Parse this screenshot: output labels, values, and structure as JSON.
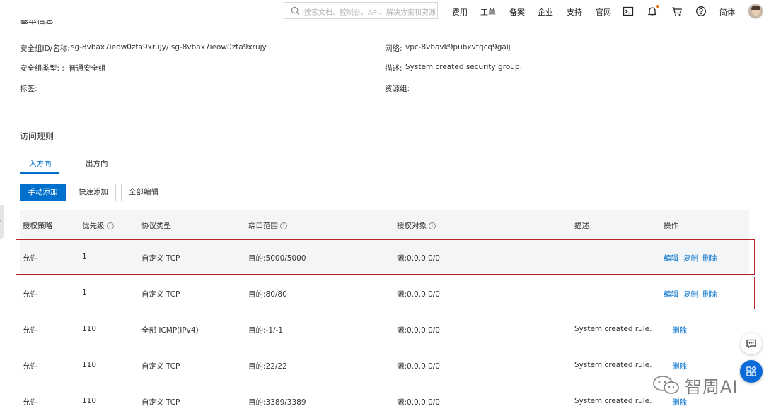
{
  "topbar": {
    "search_placeholder": "搜索文档、控制台、API、解决方案和资源",
    "nav": [
      "费用",
      "工单",
      "备案",
      "企业",
      "支持",
      "官网"
    ],
    "lang": "简体"
  },
  "basic_info": {
    "section_title": "基本信息",
    "sg_id_label": "安全组ID/名称:",
    "sg_id_value": "sg-8vbax7ieow0zta9xrujy/ sg-8vbax7ieow0zta9xrujy",
    "sg_type_label": "安全组类型: :",
    "sg_type_value": "普通安全组",
    "tags_label": "标签:",
    "network_label": "网络:",
    "network_value": "vpc-8vbavk9pubxvtqcq9gaij",
    "desc_label": "描述:",
    "desc_value": "System created security group.",
    "resource_group_label": "资源组:"
  },
  "rules": {
    "title": "访问规则",
    "tabs": [
      "入方向",
      "出方向"
    ],
    "active_tab": "入方向",
    "buttons": {
      "manual_add": "手动添加",
      "quick_add": "快速添加",
      "edit_all": "全部编辑"
    },
    "columns": [
      "授权策略",
      "优先级",
      "协议类型",
      "端口范围",
      "授权对象",
      "描述",
      "操作"
    ],
    "rows": [
      {
        "policy": "允许",
        "priority": "1",
        "protocol": "自定义 TCP",
        "port": "目的:5000/5000",
        "target": "源:0.0.0.0/0",
        "desc": "",
        "ops": [
          "编辑",
          "复制",
          "删除"
        ]
      },
      {
        "policy": "允许",
        "priority": "1",
        "protocol": "自定义 TCP",
        "port": "目的:80/80",
        "target": "源:0.0.0.0/0",
        "desc": "",
        "ops": [
          "编辑",
          "复制",
          "删除"
        ]
      },
      {
        "policy": "允许",
        "priority": "110",
        "protocol": "全部 ICMP(IPv4)",
        "port": "目的:-1/-1",
        "target": "源:0.0.0.0/0",
        "desc": "System created rule.",
        "ops": [
          "删除"
        ]
      },
      {
        "policy": "允许",
        "priority": "110",
        "protocol": "自定义 TCP",
        "port": "目的:22/22",
        "target": "源:0.0.0.0/0",
        "desc": "System created rule.",
        "ops": [
          "删除"
        ]
      },
      {
        "policy": "允许",
        "priority": "110",
        "protocol": "自定义 TCP",
        "port": "目的:3389/3389",
        "target": "源:0.0.0.0/0",
        "desc": "System created rule.",
        "ops": [
          "删除"
        ]
      }
    ]
  },
  "watermark": {
    "text": "智周AI"
  },
  "colors": {
    "accent": "#0070cc",
    "highlight_border": "#b8262b",
    "header_bg": "#f5f5f6"
  }
}
